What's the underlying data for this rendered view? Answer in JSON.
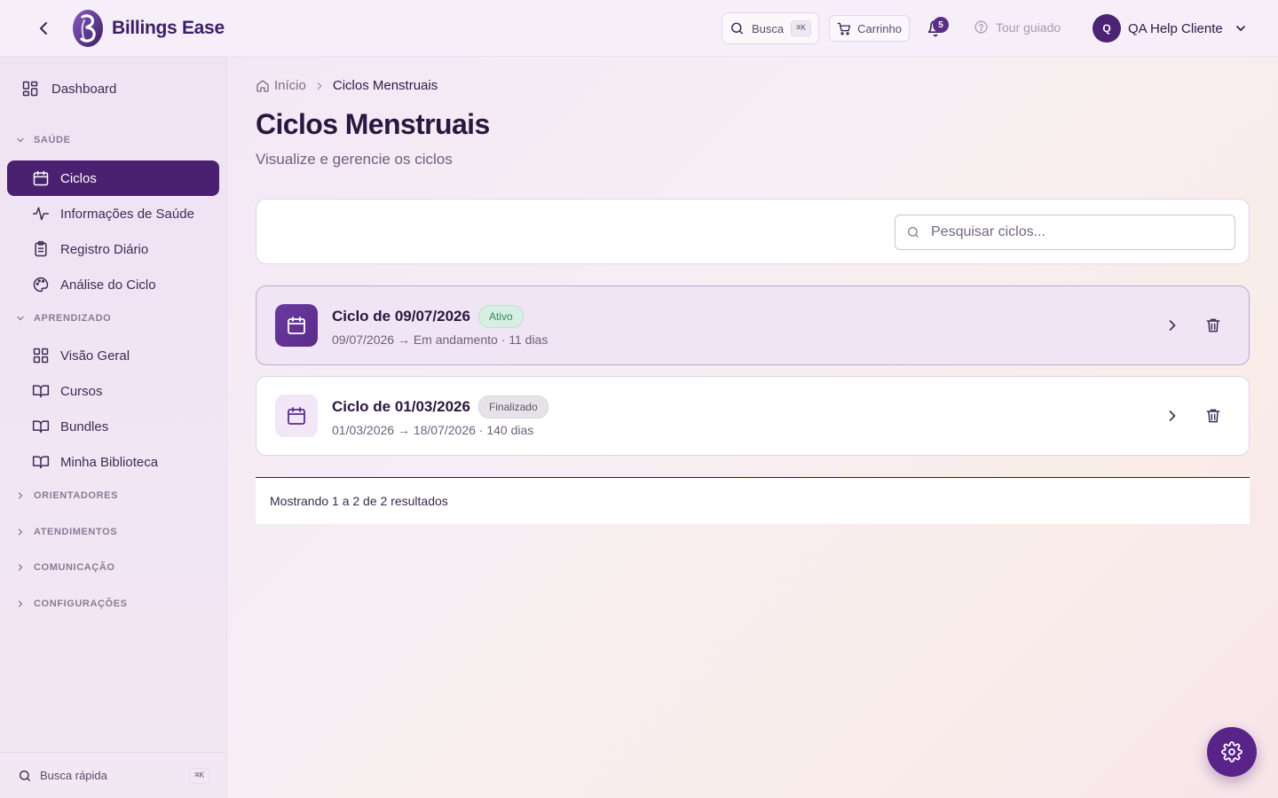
{
  "header": {
    "brand_name": "Billings Ease",
    "search_label": "Busca",
    "search_shortcut": "⌘K",
    "cart_label": "Carrinho",
    "notifications_count": "5",
    "tour_label": "Tour guiado",
    "user_initial": "Q",
    "user_name": "QA Help Cliente"
  },
  "sidebar": {
    "dashboard_label": "Dashboard",
    "sections": {
      "saude": "SAÚDE",
      "aprendizado": "APRENDIZADO",
      "orientadores": "ORIENTADORES",
      "atendimentos": "ATENDIMENTOS",
      "comunicacao": "COMUNICAÇÃO",
      "configuracoes": "CONFIGURAÇÕES"
    },
    "saude_items": [
      "Ciclos",
      "Informações de Saúde",
      "Registro Diário",
      "Análise do Ciclo"
    ],
    "aprendizado_items": [
      "Visão Geral",
      "Cursos",
      "Bundles",
      "Minha Biblioteca"
    ],
    "active_item": "Ciclos",
    "quick_search_label": "Busca rápida",
    "quick_search_shortcut": "⌘K"
  },
  "main": {
    "breadcrumb": {
      "home": "Início",
      "current": "Ciclos Menstruais"
    },
    "title": "Ciclos Menstruais",
    "subtitle": "Visualize e gerencie os ciclos",
    "search_placeholder": "Pesquisar ciclos...",
    "cycles": [
      {
        "title": "Ciclo de 09/07/2026",
        "status": "Ativo",
        "meta": "09/07/2026 → Em andamento · 11 dias"
      },
      {
        "title": "Ciclo de 01/03/2026",
        "status": "Finalizado",
        "meta": "01/03/2026 → 18/07/2026 · 140 dias"
      }
    ],
    "pagination": "Mostrando 1 a 2 de 2 resultados"
  },
  "colors": {
    "primary": "#4a2170",
    "active_badge": "#d6efe2",
    "finished_badge": "#e6e3e8"
  },
  "icons": {
    "back": "chevron-left-icon",
    "search": "search-icon",
    "cart": "cart-icon",
    "bell": "bell-icon",
    "help": "help-circle-icon",
    "calendar": "calendar-icon",
    "chevron_right": "chevron-right-icon",
    "trash": "trash-icon",
    "settings": "gear-icon"
  }
}
